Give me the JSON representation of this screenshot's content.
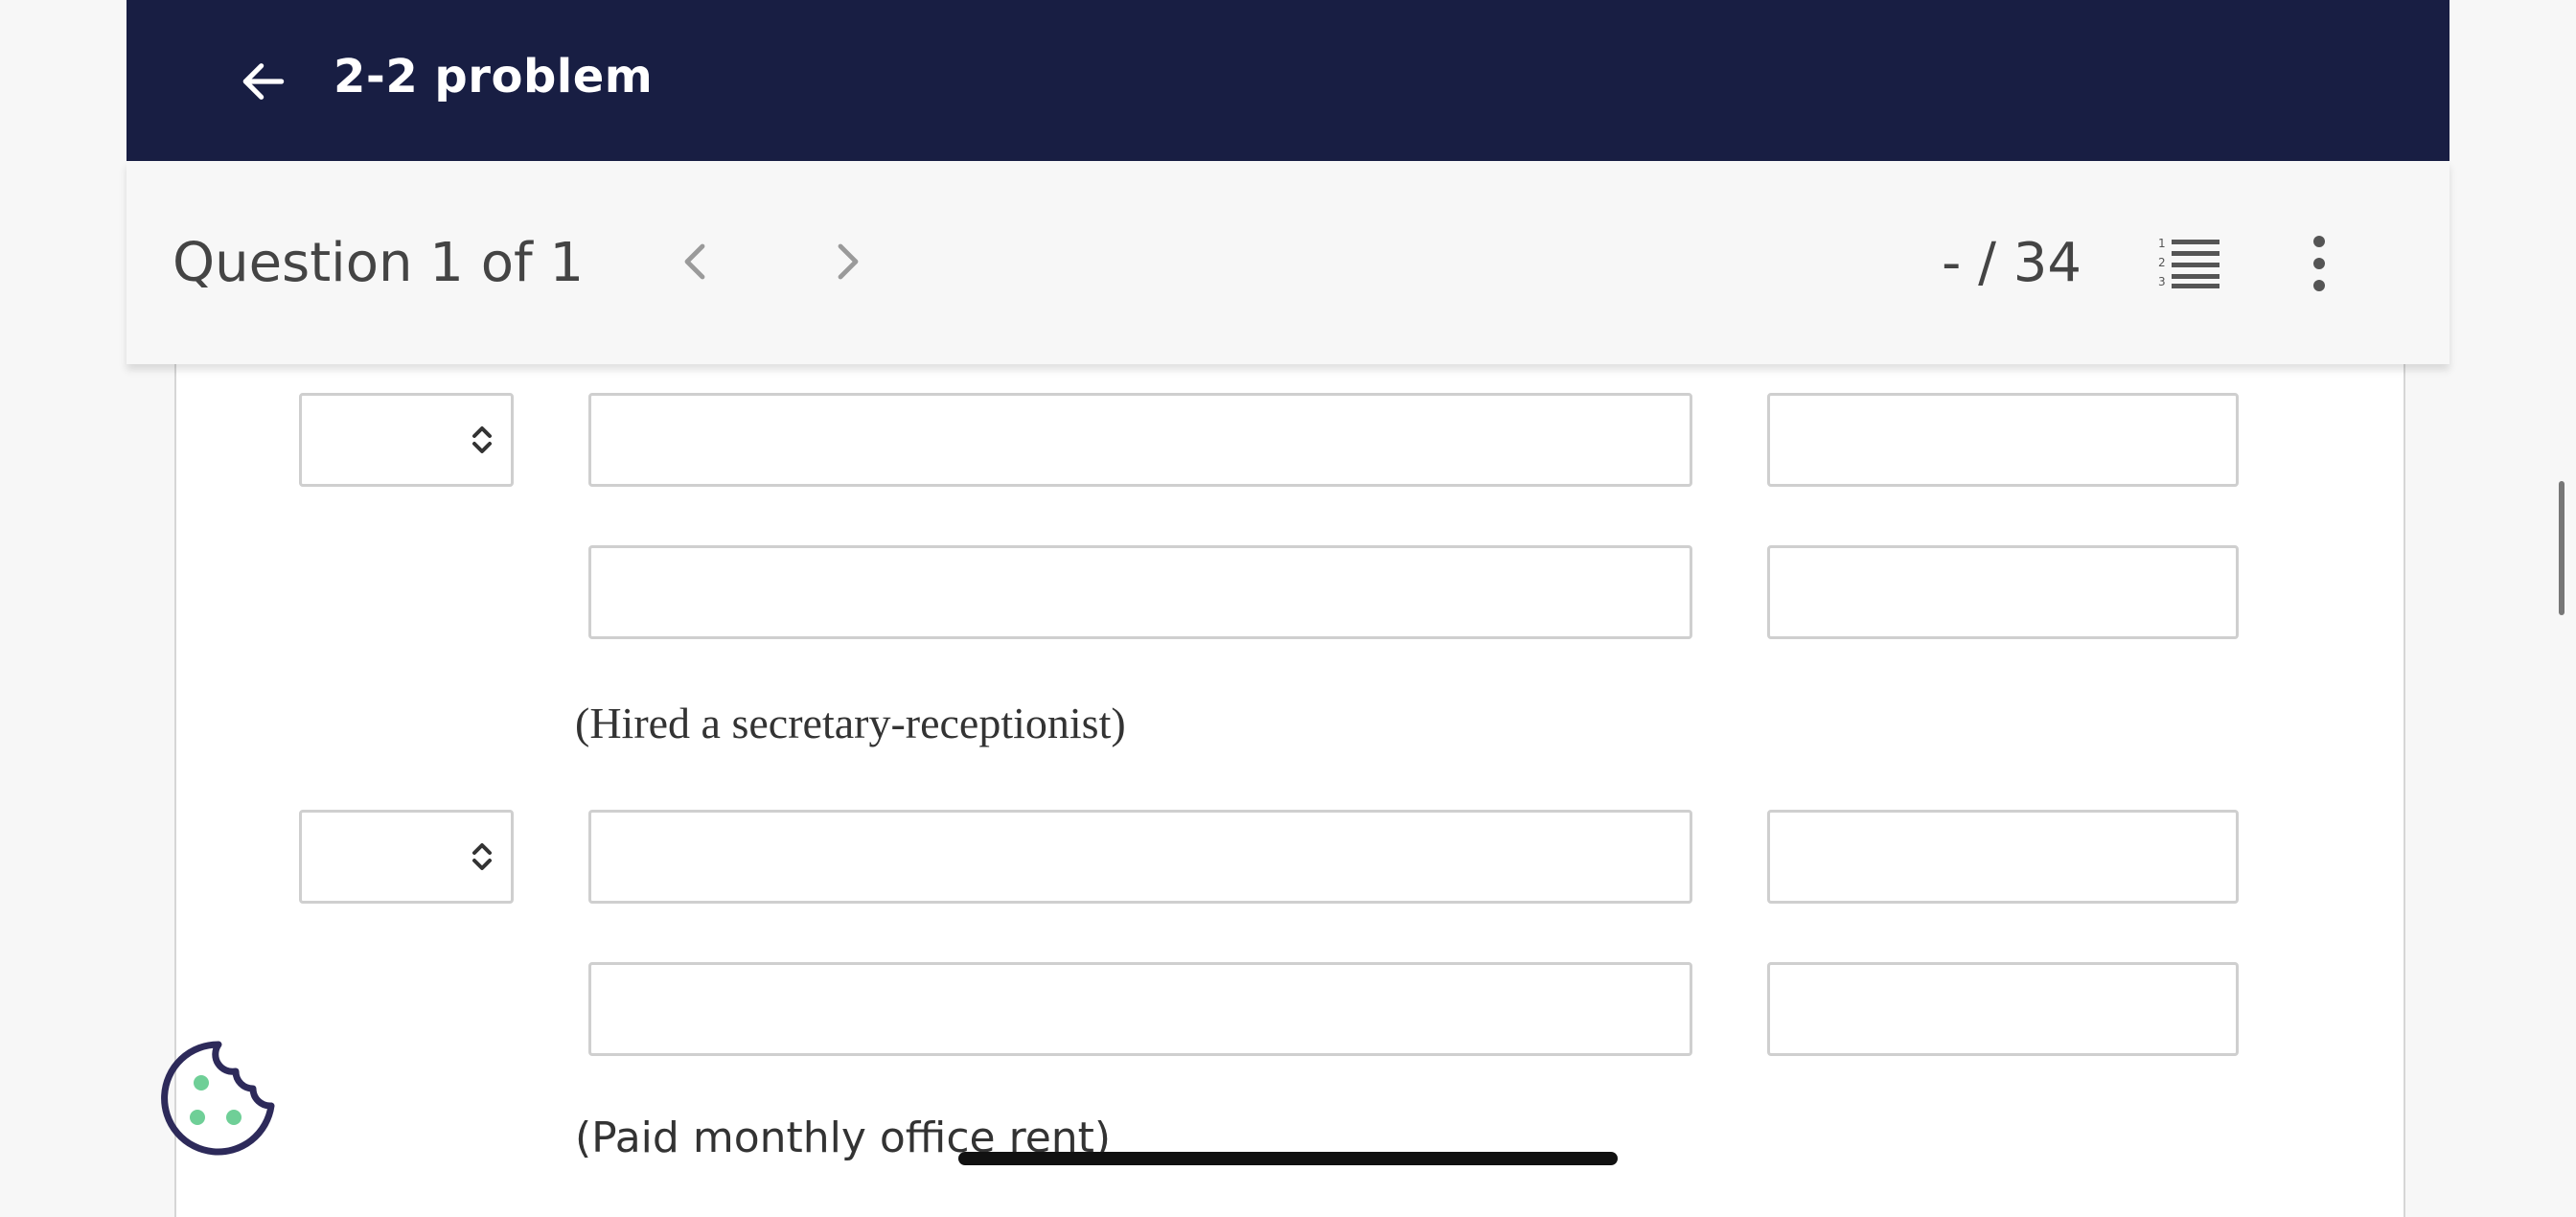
{
  "header": {
    "title": "2-2 problem",
    "back_icon": "arrow-left-icon"
  },
  "question_bar": {
    "label": "Question 1 of 1",
    "prev_icon": "chevron-left-icon",
    "next_icon": "chevron-right-icon",
    "score": "- / 34",
    "list_icon": "numbered-list-icon",
    "more_icon": "more-vertical-icon"
  },
  "entries": [
    {
      "description": "(Hired a secretary-receptionist)"
    },
    {
      "description": "(Paid monthly office rent)"
    }
  ],
  "fields": {
    "select_value": "",
    "account_value": "",
    "amount_value": ""
  },
  "colors": {
    "header_bg": "#181e43",
    "cookie_stroke": "#2d2a5a",
    "cookie_dots": "#6fcf97"
  }
}
